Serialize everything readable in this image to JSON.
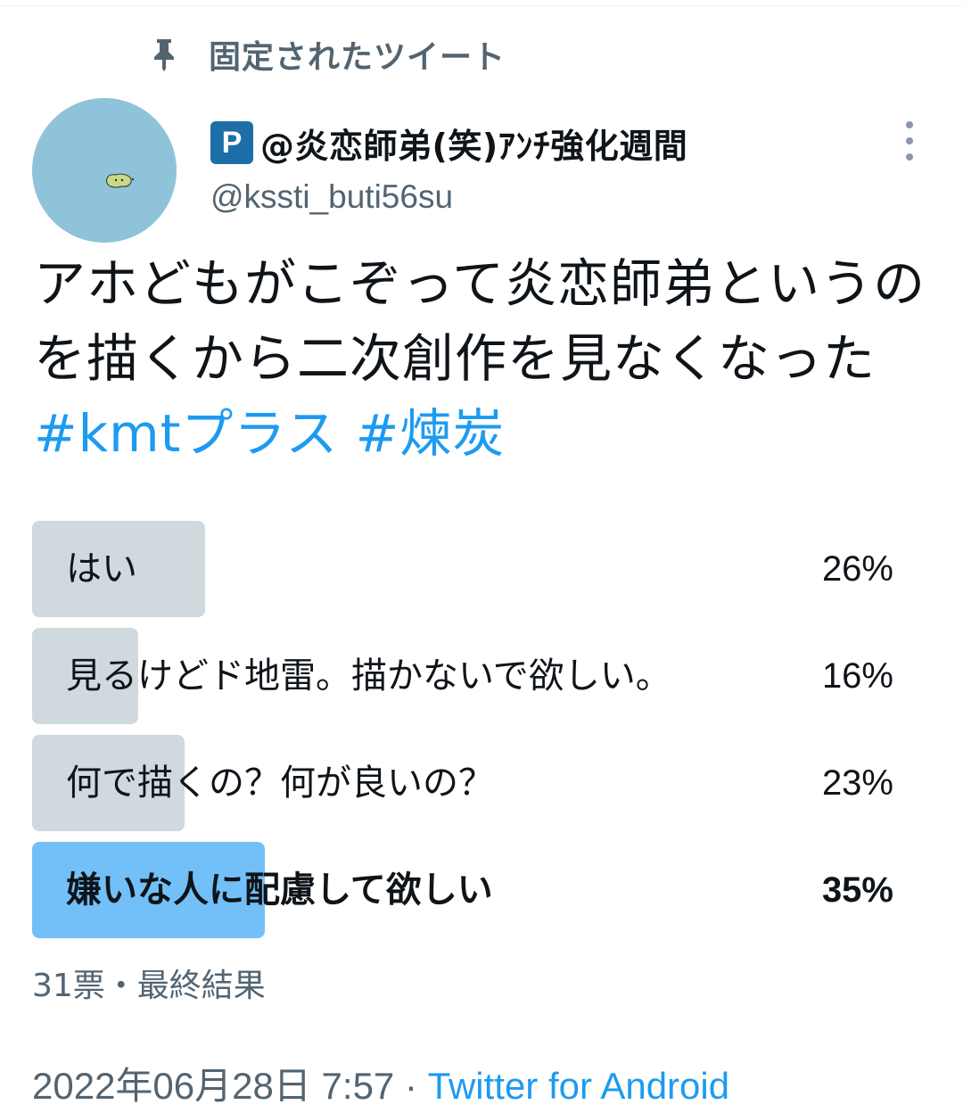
{
  "pinned": {
    "label": "固定されたツイート",
    "icon": "pin-icon"
  },
  "user": {
    "badge": "P",
    "display_name": "@炎恋師弟(笑)ｱﾝﾁ強化週間",
    "handle": "@kssti_buti56su",
    "avatar_color": "#8fc3da"
  },
  "tweet": {
    "text": "アホどもがこぞって炎恋師弟というのを描くから二次創作を見なくなった ",
    "hashtags": [
      "#kmtプラス",
      "#煉炭"
    ]
  },
  "poll": {
    "options": [
      {
        "label": "はい",
        "percent": "26%",
        "fraction": 0.26,
        "winner": false
      },
      {
        "label": "見るけどド地雷。描かないで欲しい。",
        "percent": "16%",
        "fraction": 0.16,
        "winner": false
      },
      {
        "label": "何で描くの？何が良いの？",
        "percent": "23%",
        "fraction": 0.23,
        "winner": false
      },
      {
        "label": "嫌いな人に配慮して欲しい",
        "percent": "35%",
        "fraction": 0.35,
        "winner": true
      }
    ],
    "meta": "31票・最終結果",
    "colors": {
      "bar": "#cfd9de",
      "winner_bar": "#72c0f7"
    }
  },
  "footer": {
    "timestamp": "2022年06月28日 7:57",
    "separator": " · ",
    "source": "Twitter for Android"
  },
  "colors": {
    "link": "#1d9bf0",
    "secondary_text": "#536471",
    "primary_text": "#0f1419"
  }
}
